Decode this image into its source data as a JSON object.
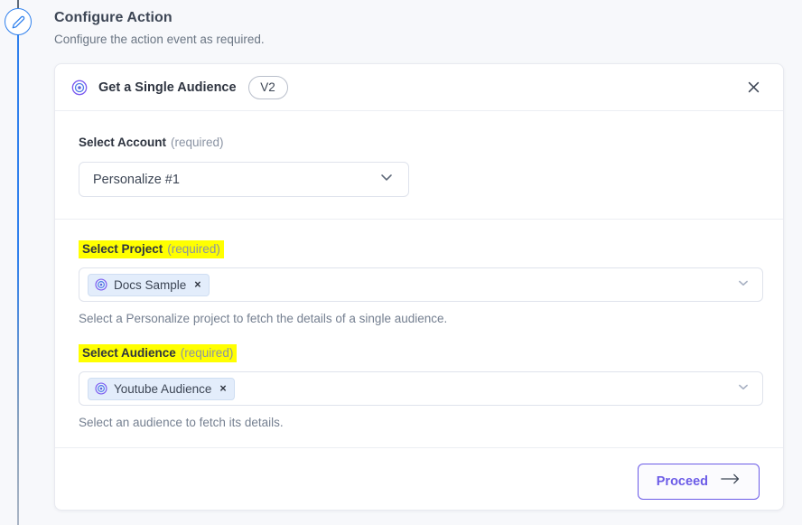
{
  "page": {
    "title": "Configure Action",
    "subtitle": "Configure the action event as required."
  },
  "rail": {
    "icon": "pencil-icon"
  },
  "card": {
    "header": {
      "icon": "bullseye-icon",
      "action_title": "Get a Single Audience",
      "version_badge": "V2",
      "close_icon": "close-icon"
    },
    "account_field": {
      "label": "Select Account",
      "required_text": "(required)",
      "value": "Personalize #1",
      "chevron_icon": "chevron-down-icon"
    },
    "project_field": {
      "label": "Select Project",
      "required_text": "(required)",
      "highlighted": true,
      "chip": {
        "icon": "bullseye-icon",
        "label": "Docs Sample",
        "remove_icon": "×"
      },
      "helper": "Select a Personalize project to fetch the details of a single audience.",
      "chevron_icon": "chevron-down-icon"
    },
    "audience_field": {
      "label": "Select Audience",
      "required_text": "(required)",
      "highlighted": true,
      "chip": {
        "icon": "bullseye-icon",
        "label": "Youtube Audience",
        "remove_icon": "×"
      },
      "helper": "Select an audience to fetch its details.",
      "chevron_icon": "chevron-down-icon"
    },
    "footer": {
      "proceed_label": "Proceed",
      "proceed_icon": "arrow-right-icon"
    }
  },
  "colors": {
    "accent_purple": "#6c5ce7",
    "rail_blue": "#2f80ed",
    "highlight_yellow": "#ffff00",
    "chip_bg": "#e3edfb",
    "page_bg": "#f7f8fb"
  }
}
